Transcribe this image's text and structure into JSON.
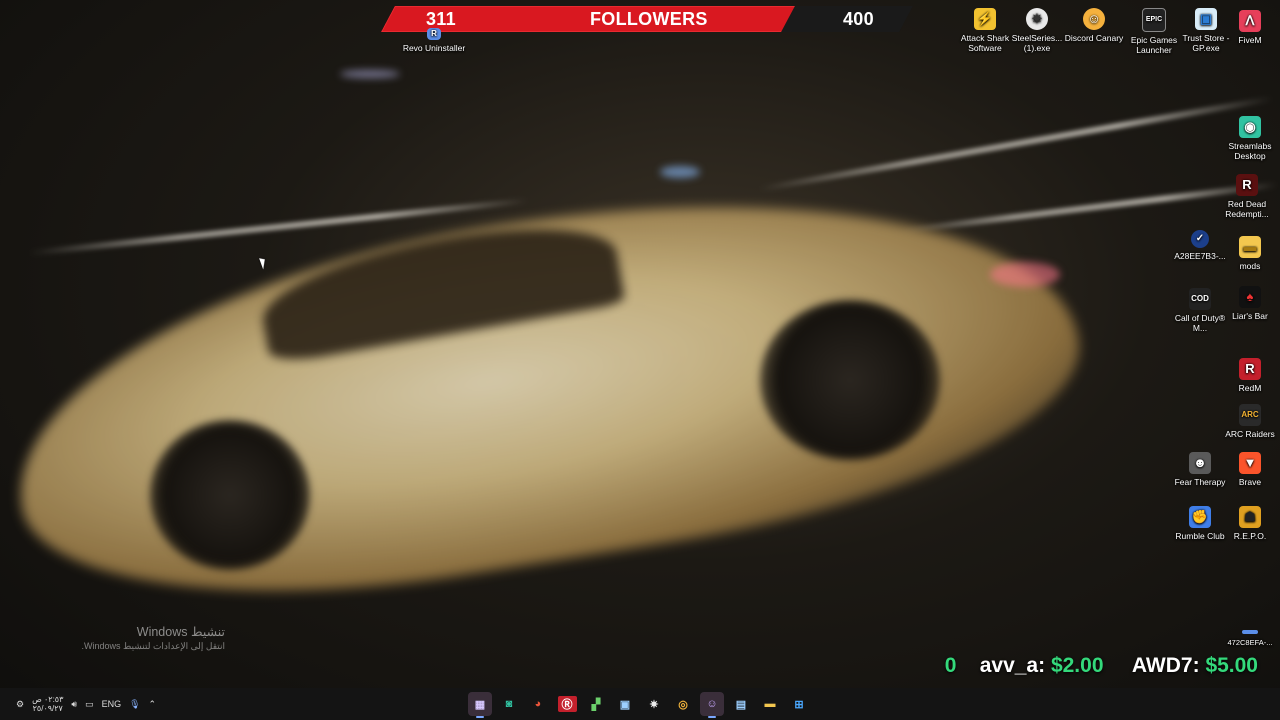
{
  "followers_bar": {
    "current": "311",
    "label": "FOLLOWERS",
    "goal": "400",
    "accent_color": "#d91820"
  },
  "desktop_icons": {
    "revo": "Revo Uninstaller",
    "attack_shark": "Attack Shark Software",
    "steelseries": "SteelSeries... (1).exe",
    "discord_canary": "Discord Canary",
    "epic": "Epic Games Launcher",
    "trust_store": "Trust Store - GP.exe",
    "fivem": "FiveM",
    "streamlabs": "Streamlabs Desktop",
    "red_dead": "Red Dead Redempti...",
    "a28ee": "A28EE7B3-...",
    "mods": "mods",
    "cod": "Call of Duty® M...",
    "liars_bar": "Liar's Bar",
    "redm": "RedM",
    "arc_raiders": "ARC Raiders",
    "fear_therapy": "Fear Therapy",
    "brave": "Brave",
    "rumble_club": "Rumble Club",
    "repo": "R.E.P.O.",
    "hash_472": "472C8EFA-..."
  },
  "activation": {
    "title": "تنشيط Windows",
    "subtitle": "انتقل إلى الإعدادات لتنشيط Windows."
  },
  "ticker": {
    "partial": "0",
    "d1_name": "avv_a:",
    "d1_amount": "$2.00",
    "d2_name": "AWD7:",
    "d2_amount": "$5.00"
  },
  "taskbar": {
    "time": "٠٢:٥٣ ص",
    "date": "٢٥/٠٩/٢٧",
    "language": "ENG",
    "icons": [
      "streamlabs-icon",
      "xbox-icon",
      "color-wheel-icon",
      "red-app-icon",
      "apps-icon",
      "media-icon",
      "steelseries-icon",
      "chrome-icon",
      "discord-icon",
      "store-icon",
      "explorer-icon",
      "windows-icon"
    ]
  }
}
